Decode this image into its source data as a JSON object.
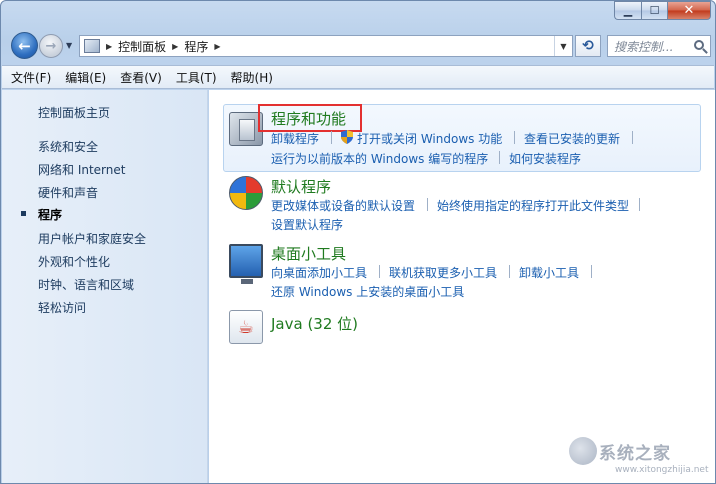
{
  "window": {
    "controls": {
      "minimize": "▁",
      "maximize": "☐",
      "close": "✕"
    }
  },
  "nav": {
    "back": "←",
    "forward": "→",
    "breadcrumbs": [
      "控制面板",
      "程序"
    ],
    "search_placeholder": "搜索控制..."
  },
  "menu": [
    "文件(F)",
    "编辑(E)",
    "查看(V)",
    "工具(T)",
    "帮助(H)"
  ],
  "sidebar": {
    "items": [
      {
        "label": "控制面板主页"
      },
      {
        "label": "系统和安全"
      },
      {
        "label": "网络和 Internet"
      },
      {
        "label": "硬件和声音"
      },
      {
        "label": "程序",
        "active": true
      },
      {
        "label": "用户帐户和家庭安全"
      },
      {
        "label": "外观和个性化"
      },
      {
        "label": "时钟、语言和区域"
      },
      {
        "label": "轻松访问"
      }
    ]
  },
  "categories": [
    {
      "title": "程序和功能",
      "icon": "programs-icon",
      "links_row1": [
        "卸载程序",
        "打开或关闭 Windows 功能",
        "查看已安装的更新"
      ],
      "links_row2": [
        "运行为以前版本的 Windows 编写的程序",
        "如何安装程序"
      ]
    },
    {
      "title": "默认程序",
      "icon": "default-programs-icon",
      "links_row1": [
        "更改媒体或设备的默认设置",
        "始终使用指定的程序打开此文件类型"
      ],
      "links_row2": [
        "设置默认程序"
      ]
    },
    {
      "title": "桌面小工具",
      "icon": "desktop-gadgets-icon",
      "links_row1": [
        "向桌面添加小工具",
        "联机获取更多小工具",
        "卸载小工具"
      ],
      "links_row2": [
        "还原 Windows 上安装的桌面小工具"
      ]
    },
    {
      "title": "Java (32 位)",
      "icon": "java-icon",
      "glyph": "☕"
    }
  ],
  "watermark": {
    "text": "系统之家",
    "url": "www.xitongzhijia.net"
  }
}
